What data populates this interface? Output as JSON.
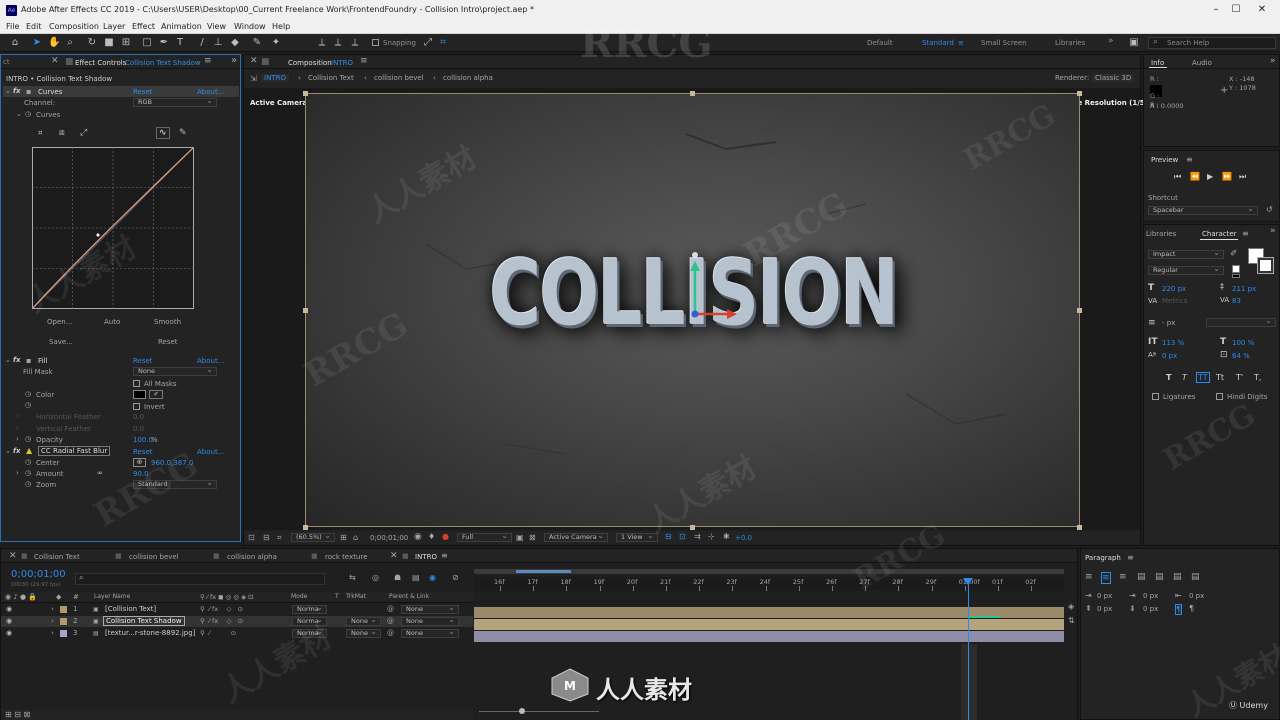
{
  "window": {
    "title": "Adobe After Effects CC 2019 - C:\\Users\\USER\\Desktop\\00_Current Freelance Work\\FrontendFoundry - Collision Intro\\project.aep *",
    "icon_text": "Ae"
  },
  "menu": [
    "File",
    "Edit",
    "Composition",
    "Layer",
    "Effect",
    "Animation",
    "View",
    "Window",
    "Help"
  ],
  "toolbar": {
    "snapping": "Snapping",
    "workspaces": [
      "Default",
      "Standard",
      "Small Screen",
      "Libraries"
    ],
    "active_workspace": "Standard",
    "search_placeholder": "Search Help"
  },
  "effect_controls": {
    "tab_prefix": "Effect Controls",
    "tab_layer": "Collision Text Shadow",
    "header": "INTRO • Collision Text Shadow",
    "curves": {
      "name": "Curves",
      "reset": "Reset",
      "about": "About...",
      "channel_label": "Channel:",
      "channel_value": "RGB",
      "curves_label": "Curves",
      "buttons": [
        "Open...",
        "Auto",
        "Smooth",
        "Save...",
        "Reset"
      ]
    },
    "fill": {
      "name": "Fill",
      "reset": "Reset",
      "about": "About...",
      "fill_mask_label": "Fill Mask",
      "fill_mask_value": "None",
      "all_masks": "All Masks",
      "color_label": "Color",
      "invert": "Invert",
      "horizontal_feather": "Horizontal Feather",
      "horizontal_feather_value": "0.0",
      "vertical_feather": "Vertical Feather",
      "vertical_feather_value": "0.0",
      "opacity_label": "Opacity",
      "opacity_value": "100.0",
      "opacity_unit": "%"
    },
    "radial_blur": {
      "name": "CC Radial Fast Blur",
      "reset": "Reset",
      "about": "About...",
      "center_label": "Center",
      "center_value": "960.0,387.0",
      "amount_label": "Amount",
      "amount_value": "90.0",
      "zoom_label": "Zoom",
      "zoom_value": "Standard"
    }
  },
  "composition": {
    "tab_prefix": "Composition",
    "tab_name": "INTRO",
    "breadcrumbs": [
      "INTRO",
      "Collision Text",
      "collision bevel",
      "collision alpha"
    ],
    "renderer_label": "Renderer:",
    "renderer_value": "Classic 3D",
    "active_camera": "Active Camera",
    "adaptive": "Adaptive Resolution (1/5)",
    "title_text": "COLLISION",
    "footer": {
      "zoom": "(60.5%)",
      "timecode": "0;00;01;00",
      "resolution": "Full",
      "camera": "Active Camera",
      "views": "1 View",
      "exposure": "+0.0"
    }
  },
  "info": {
    "tabs": [
      "Info",
      "Audio"
    ],
    "rows": [
      "R :",
      "G :",
      "B :",
      "A : 0.0000"
    ],
    "x": "X : -148",
    "y": "Y : 1078"
  },
  "preview": {
    "title": "Preview",
    "shortcut_label": "Shortcut",
    "shortcut_value": "Spacebar"
  },
  "character": {
    "tabs": [
      "Libraries",
      "Character"
    ],
    "font": "Impact",
    "style": "Regular",
    "size": "220 px",
    "leading": "211 px",
    "kerning": "Metrics",
    "tracking": "83",
    "stroke_width": "- px",
    "vscale": "113 %",
    "hscale": "100 %",
    "baseline": "0 px",
    "tsume": "64 %",
    "styles": [
      "T",
      "T",
      "TT",
      "Tt",
      "T'",
      "T,"
    ],
    "ligatures": "Ligatures",
    "hindi": "Hindi Digits"
  },
  "paragraph": {
    "title": "Paragraph",
    "indents": [
      "0 px",
      "0 px",
      "0 px",
      "0 px",
      "0 px"
    ]
  },
  "timeline": {
    "tabs": [
      "Collision Text",
      "collision bevel",
      "collision alpha",
      "rock texture",
      "INTRO"
    ],
    "active_tab": "INTRO",
    "timecode": "0;00;01;00",
    "fps": "00030 (29.97 fps)",
    "search_placeholder": "",
    "columns": {
      "layer_name": "Layer Name",
      "mode": "Mode",
      "t": "T",
      "trkmat": "TrkMat",
      "parent": "Parent & Link"
    },
    "ruler": [
      "16f",
      "17f",
      "18f",
      "19f",
      "20f",
      "21f",
      "22f",
      "23f",
      "24f",
      "25f",
      "26f",
      "27f",
      "28f",
      "29f",
      "01:00f",
      "01f",
      "02f"
    ],
    "layers": [
      {
        "num": "1",
        "name": "[Collision Text]",
        "mode": "Norma",
        "trkmat": "",
        "parent": "None",
        "label": "#b39a6e"
      },
      {
        "num": "2",
        "name": "Collision Text Shadow",
        "mode": "Norma",
        "trkmat": "None",
        "parent": "None",
        "label": "#b39a6e"
      },
      {
        "num": "3",
        "name": "[textur...r-stone-8892.jpg]",
        "mode": "Norma",
        "trkmat": "None",
        "parent": "None",
        "label": "#a6a6c8"
      }
    ]
  },
  "watermarks": {
    "brand": "RRCG",
    "cn": "人人素材",
    "bottom": "人人素材",
    "udemy": "Udemy"
  }
}
